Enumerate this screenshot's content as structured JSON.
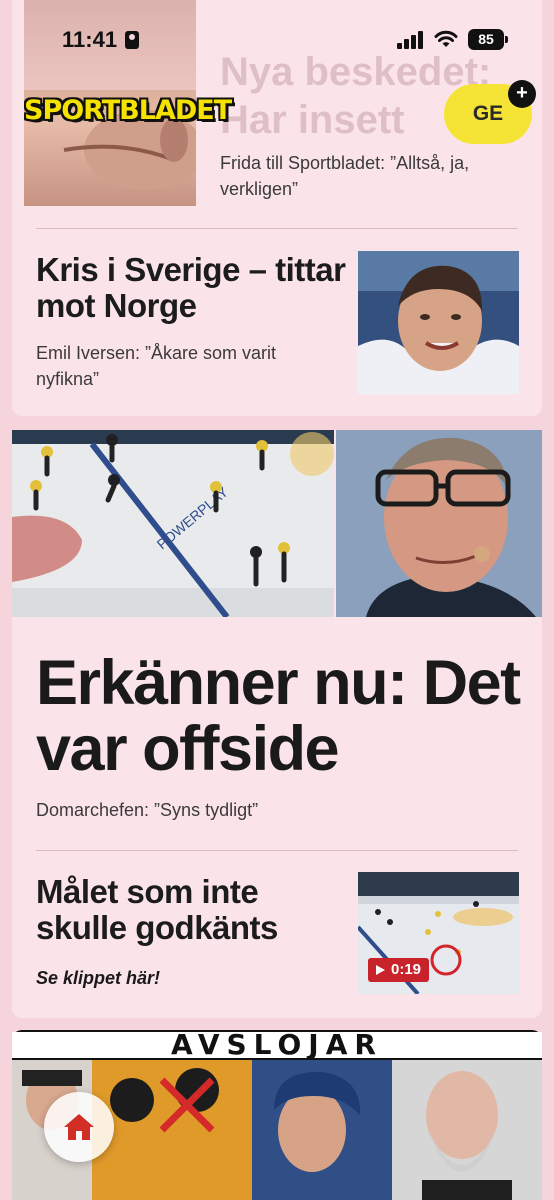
{
  "status_bar": {
    "time": "11:41",
    "battery": "85"
  },
  "header": {
    "logo_text": "SPORTBLADET",
    "profile_initials": "GE",
    "profile_badge": "+"
  },
  "feed": {
    "article1": {
      "headline_faded": "Nya beskedet: Har insett",
      "subtitle": "Frida till Sportbladet: ”Alltså, ja, verkligen”"
    },
    "article2": {
      "headline": "Kris i Sverige – tittar mot Norge",
      "subtitle": "Emil Iversen: ”Åkare som varit nyfikna”"
    },
    "article3": {
      "headline": "Erkänner nu: Det var offside",
      "subtitle": "Domarchefen: ”Syns tydligt”"
    },
    "article4": {
      "headline": "Målet som inte skulle godkänts",
      "subtitle": "Se klippet här!",
      "video_duration": "0:19"
    },
    "article5": {
      "banner": "AVSLÖJAR"
    }
  },
  "icons": {
    "home": "home-icon",
    "play": "play-icon",
    "signal": "signal-icon",
    "wifi": "wifi-icon",
    "battery": "battery-icon"
  },
  "colors": {
    "background": "#f6d4dc",
    "card": "#fbe4e9",
    "brand_yellow": "#f5e200",
    "video_red": "#c8222a"
  }
}
